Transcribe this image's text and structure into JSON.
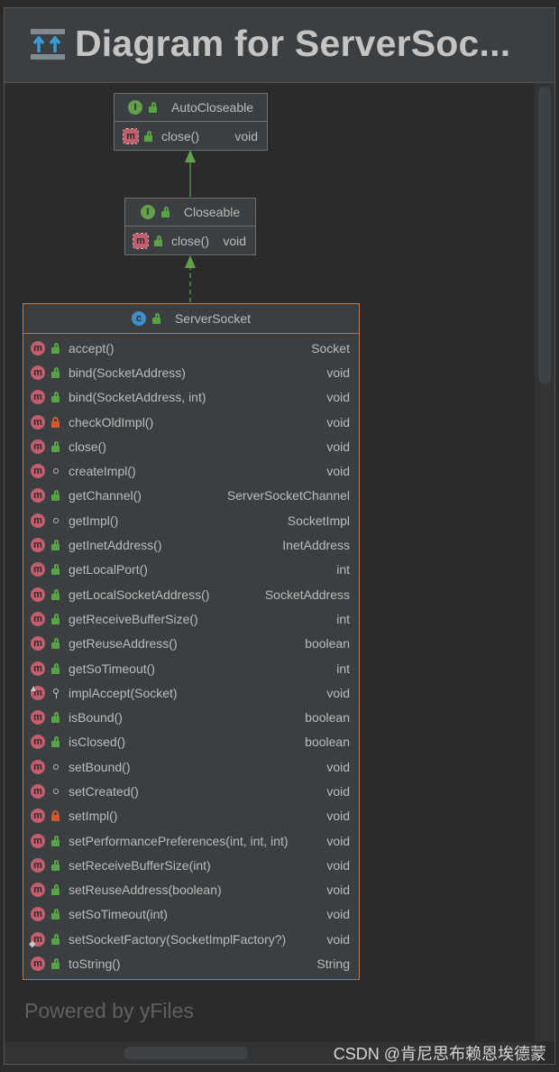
{
  "window": {
    "title": "Diagram for ServerSoc..."
  },
  "footer": {
    "powered_by": "Powered by yFiles",
    "watermark": "CSDN @肯尼思布赖恩埃德蒙"
  },
  "colors": {
    "background": "#2b2b2b",
    "node_fill": "#3c3f41",
    "node_border": "#6e6e6e",
    "selected_border": "#c87833",
    "edge": "#62a04c",
    "interface_icon": "#62a04c",
    "class_icon": "#3f8fc8",
    "method_icon": "#c25e6e"
  },
  "nodes": {
    "autocloseable": {
      "kind": "interface",
      "name": "AutoCloseable",
      "methods": [
        {
          "name": "close()",
          "type": "void",
          "visibility": "public",
          "abstract": true
        }
      ]
    },
    "closeable": {
      "kind": "interface",
      "name": "Closeable",
      "methods": [
        {
          "name": "close()",
          "type": "void",
          "visibility": "public",
          "abstract": true
        }
      ]
    },
    "serversocket": {
      "kind": "class",
      "name": "ServerSocket",
      "methods": [
        {
          "name": "accept()",
          "type": "Socket",
          "visibility": "public"
        },
        {
          "name": "bind(SocketAddress)",
          "type": "void",
          "visibility": "public"
        },
        {
          "name": "bind(SocketAddress, int)",
          "type": "void",
          "visibility": "public"
        },
        {
          "name": "checkOldImpl()",
          "type": "void",
          "visibility": "private"
        },
        {
          "name": "close()",
          "type": "void",
          "visibility": "public"
        },
        {
          "name": "createImpl()",
          "type": "void",
          "visibility": "package"
        },
        {
          "name": "getChannel()",
          "type": "ServerSocketChannel",
          "visibility": "public"
        },
        {
          "name": "getImpl()",
          "type": "SocketImpl",
          "visibility": "package"
        },
        {
          "name": "getInetAddress()",
          "type": "InetAddress",
          "visibility": "public"
        },
        {
          "name": "getLocalPort()",
          "type": "int",
          "visibility": "public"
        },
        {
          "name": "getLocalSocketAddress()",
          "type": "SocketAddress",
          "visibility": "public"
        },
        {
          "name": "getReceiveBufferSize()",
          "type": "int",
          "visibility": "public"
        },
        {
          "name": "getReuseAddress()",
          "type": "boolean",
          "visibility": "public"
        },
        {
          "name": "getSoTimeout()",
          "type": "int",
          "visibility": "public"
        },
        {
          "name": "implAccept(Socket)",
          "type": "void",
          "visibility": "protected",
          "overlay": "override"
        },
        {
          "name": "isBound()",
          "type": "boolean",
          "visibility": "public"
        },
        {
          "name": "isClosed()",
          "type": "boolean",
          "visibility": "public"
        },
        {
          "name": "setBound()",
          "type": "void",
          "visibility": "package"
        },
        {
          "name": "setCreated()",
          "type": "void",
          "visibility": "package"
        },
        {
          "name": "setImpl()",
          "type": "void",
          "visibility": "private"
        },
        {
          "name": "setPerformancePreferences(int, int, int)",
          "type": "void",
          "visibility": "public"
        },
        {
          "name": "setReceiveBufferSize(int)",
          "type": "void",
          "visibility": "public"
        },
        {
          "name": "setReuseAddress(boolean)",
          "type": "void",
          "visibility": "public"
        },
        {
          "name": "setSoTimeout(int)",
          "type": "void",
          "visibility": "public"
        },
        {
          "name": "setSocketFactory(SocketImplFactory?)",
          "type": "void",
          "visibility": "public",
          "overlay": "static"
        },
        {
          "name": "toString()",
          "type": "String",
          "visibility": "public"
        }
      ]
    }
  },
  "edges": [
    {
      "from": "Closeable",
      "to": "AutoCloseable",
      "style": "solid",
      "relation": "extends"
    },
    {
      "from": "ServerSocket",
      "to": "Closeable",
      "style": "dashed",
      "relation": "implements"
    }
  ]
}
